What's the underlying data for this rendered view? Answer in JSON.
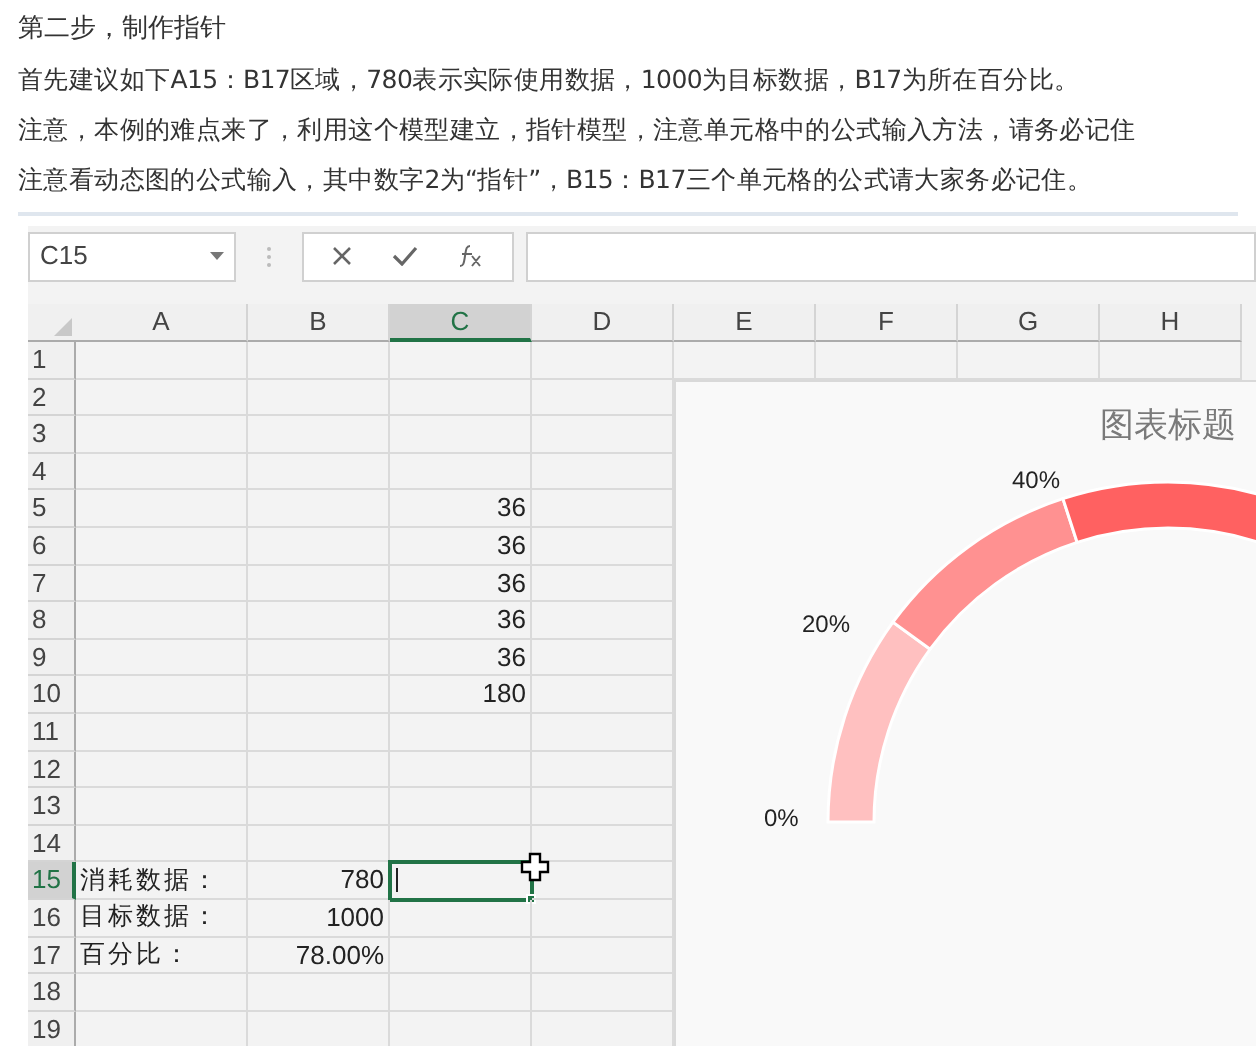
{
  "article": {
    "heading": "第二步，制作指针",
    "paragraphs": [
      "首先建议如下A15：B17区域，780表示实际使用数据，1000为目标数据，B17为所在百分比。",
      "注意，本例的难点来了，利用这个模型建立，指针模型，注意单元格中的公式输入方法，请务必记住",
      "注意看动态图的公式输入，其中数字2为“指针”，B15：B17三个单元格的公式请大家务必记住。"
    ]
  },
  "spreadsheet": {
    "name_box": "C15",
    "columns": [
      {
        "label": "A",
        "selected": false
      },
      {
        "label": "B",
        "selected": false
      },
      {
        "label": "C",
        "selected": true
      },
      {
        "label": "D",
        "selected": false
      },
      {
        "label": "E",
        "selected": false
      },
      {
        "label": "F",
        "selected": false
      },
      {
        "label": "G",
        "selected": false
      },
      {
        "label": "H",
        "selected": false
      }
    ],
    "rows": [
      {
        "label": "1",
        "selected": false
      },
      {
        "label": "2",
        "selected": false
      },
      {
        "label": "3",
        "selected": false
      },
      {
        "label": "4",
        "selected": false
      },
      {
        "label": "5",
        "selected": false,
        "c": "36"
      },
      {
        "label": "6",
        "selected": false,
        "c": "36"
      },
      {
        "label": "7",
        "selected": false,
        "c": "36"
      },
      {
        "label": "8",
        "selected": false,
        "c": "36"
      },
      {
        "label": "9",
        "selected": false,
        "c": "36"
      },
      {
        "label": "10",
        "selected": false,
        "c": "180"
      },
      {
        "label": "11",
        "selected": false
      },
      {
        "label": "12",
        "selected": false
      },
      {
        "label": "13",
        "selected": false
      },
      {
        "label": "14",
        "selected": false
      },
      {
        "label": "15",
        "selected": true,
        "a": "消耗数据：",
        "b": "780"
      },
      {
        "label": "16",
        "selected": false,
        "a": "目标数据：",
        "b": "1000"
      },
      {
        "label": "17",
        "selected": false,
        "a": "百分比：",
        "b": "78.00%"
      },
      {
        "label": "18",
        "selected": false
      },
      {
        "label": "19",
        "selected": false
      }
    ],
    "chart": {
      "title": "图表标题",
      "scale_labels": [
        "0%",
        "20%",
        "40%"
      ],
      "slices": [
        {
          "color": "#ffc0c0"
        },
        {
          "color": "#ff9191"
        },
        {
          "color": "#ff6161"
        }
      ]
    }
  }
}
